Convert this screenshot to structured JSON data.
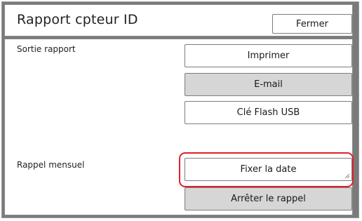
{
  "header": {
    "title": "Rapport cpteur ID",
    "close_label": "Fermer"
  },
  "report_output": {
    "label": "Sortie rapport",
    "print_label": "Imprimer",
    "email_label": "E-mail",
    "usb_label": "Clé Flash USB"
  },
  "monthly_reminder": {
    "label": "Rappel mensuel",
    "set_date_label": "Fixer la date",
    "stop_reminder_label": "Arrêter le rappel"
  },
  "colors": {
    "highlight": "#e0202a",
    "disabled_button": "#d6d6d6",
    "frame": "#7a7a7a"
  }
}
